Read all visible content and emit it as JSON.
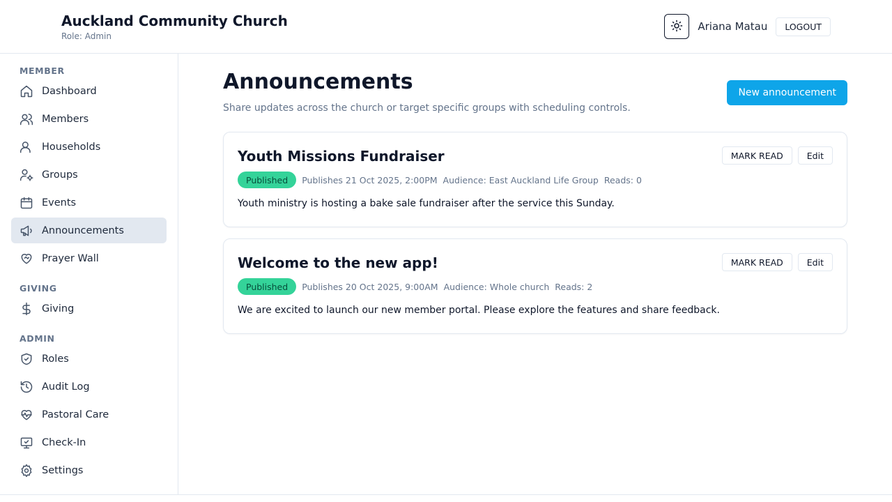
{
  "header": {
    "church_name": "Auckland Community Church",
    "role": "Role: Admin",
    "user_name": "Ariana Matau",
    "logout_label": "LOGOUT"
  },
  "sidebar": {
    "sections": [
      {
        "label": "MEMBER"
      },
      {
        "label": "GIVING"
      },
      {
        "label": "ADMIN"
      }
    ],
    "items": [
      {
        "label": "Dashboard",
        "icon": "home-icon"
      },
      {
        "label": "Members",
        "icon": "users-icon"
      },
      {
        "label": "Households",
        "icon": "user-icon"
      },
      {
        "label": "Groups",
        "icon": "user-cog-icon"
      },
      {
        "label": "Events",
        "icon": "calendar-icon"
      },
      {
        "label": "Announcements",
        "icon": "megaphone-icon",
        "active": true
      },
      {
        "label": "Prayer Wall",
        "icon": "heart-handshake-icon"
      },
      {
        "label": "Giving",
        "icon": "dollar-icon"
      },
      {
        "label": "Roles",
        "icon": "shield-check-icon"
      },
      {
        "label": "Audit Log",
        "icon": "history-icon"
      },
      {
        "label": "Pastoral Care",
        "icon": "heart-pulse-icon"
      },
      {
        "label": "Check-In",
        "icon": "monitor-check-icon"
      },
      {
        "label": "Settings",
        "icon": "gear-icon"
      }
    ]
  },
  "main": {
    "title": "Announcements",
    "subtitle": "Share updates across the church or target specific groups with scheduling controls.",
    "new_button_label": "New announcement",
    "announcements": [
      {
        "title": "Youth Missions Fundraiser",
        "status": "Published",
        "publishes": "Publishes 21 Oct 2025, 2:00PM",
        "audience": "Audience: East Auckland Life Group",
        "reads": "Reads: 0",
        "body": "Youth ministry is hosting a bake sale fundraiser after the service this Sunday.",
        "mark_read_label": "MARK READ",
        "edit_label": "Edit"
      },
      {
        "title": "Welcome to the new app!",
        "status": "Published",
        "publishes": "Publishes 20 Oct 2025, 9:00AM",
        "audience": "Audience: Whole church",
        "reads": "Reads: 2",
        "body": "We are excited to launch our new member portal. Please explore the features and share feedback.",
        "mark_read_label": "MARK READ",
        "edit_label": "Edit"
      }
    ]
  },
  "colors": {
    "accent": "#0ea5e9",
    "published_badge": "#34d399",
    "active_nav_bg": "#e2e8f0"
  }
}
